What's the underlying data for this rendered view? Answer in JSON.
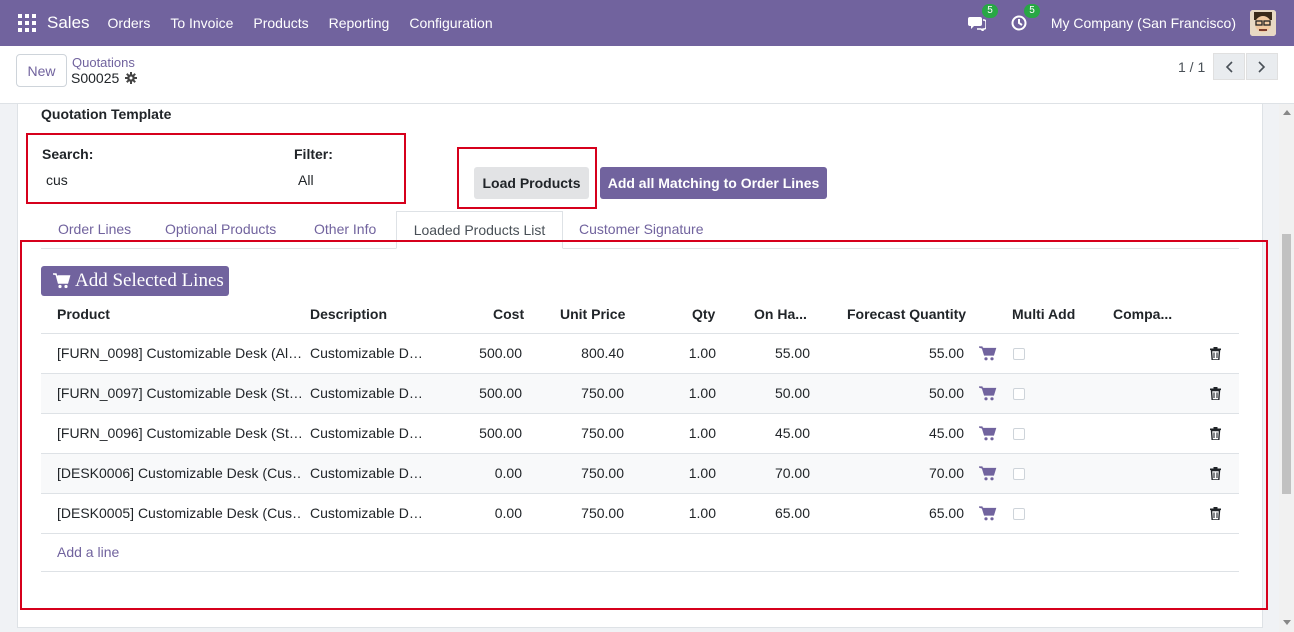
{
  "navbar": {
    "app_name": "Sales",
    "menu": [
      "Orders",
      "To Invoice",
      "Products",
      "Reporting",
      "Configuration"
    ],
    "messages_badge": "5",
    "activities_badge": "5",
    "company": "My Company (San Francisco)",
    "color": "#71639e"
  },
  "control": {
    "new_label": "New",
    "breadcrumb_parent": "Quotations",
    "record_name": "S00025",
    "pager": "1 / 1"
  },
  "form": {
    "template_label": "Quotation Template",
    "search_label": "Search:",
    "search_value": "cus",
    "filter_label": "Filter:",
    "filter_value": "All",
    "load_products_label": "Load Products",
    "add_all_label": "Add all Matching to Order Lines"
  },
  "tabs": [
    "Order Lines",
    "Optional Products",
    "Other Info",
    "Loaded Products List",
    "Customer Signature"
  ],
  "active_tab": "Loaded Products List",
  "list": {
    "add_selected_label": "Add Selected Lines",
    "columns": [
      "Product",
      "Description",
      "Cost",
      "Unit Price",
      "Qty",
      "On Ha...",
      "Forecast Quantity",
      "Multi Add",
      "Compa..."
    ],
    "rows": [
      {
        "product": "[FURN_0098] Customizable Desk (Al…",
        "description": "Customizable D…",
        "cost": "500.00",
        "unit_price": "800.40",
        "qty": "1.00",
        "on_hand": "55.00",
        "forecast": "55.00"
      },
      {
        "product": "[FURN_0097] Customizable Desk (St…",
        "description": "Customizable D…",
        "cost": "500.00",
        "unit_price": "750.00",
        "qty": "1.00",
        "on_hand": "50.00",
        "forecast": "50.00"
      },
      {
        "product": "[FURN_0096] Customizable Desk (St…",
        "description": "Customizable D…",
        "cost": "500.00",
        "unit_price": "750.00",
        "qty": "1.00",
        "on_hand": "45.00",
        "forecast": "45.00"
      },
      {
        "product": "[DESK0006] Customizable Desk (Cus…",
        "description": "Customizable D…",
        "cost": "0.00",
        "unit_price": "750.00",
        "qty": "1.00",
        "on_hand": "70.00",
        "forecast": "70.00"
      },
      {
        "product": "[DESK0005] Customizable Desk (Cus…",
        "description": "Customizable D…",
        "cost": "0.00",
        "unit_price": "750.00",
        "qty": "1.00",
        "on_hand": "65.00",
        "forecast": "65.00"
      }
    ],
    "add_line_label": "Add a line"
  }
}
